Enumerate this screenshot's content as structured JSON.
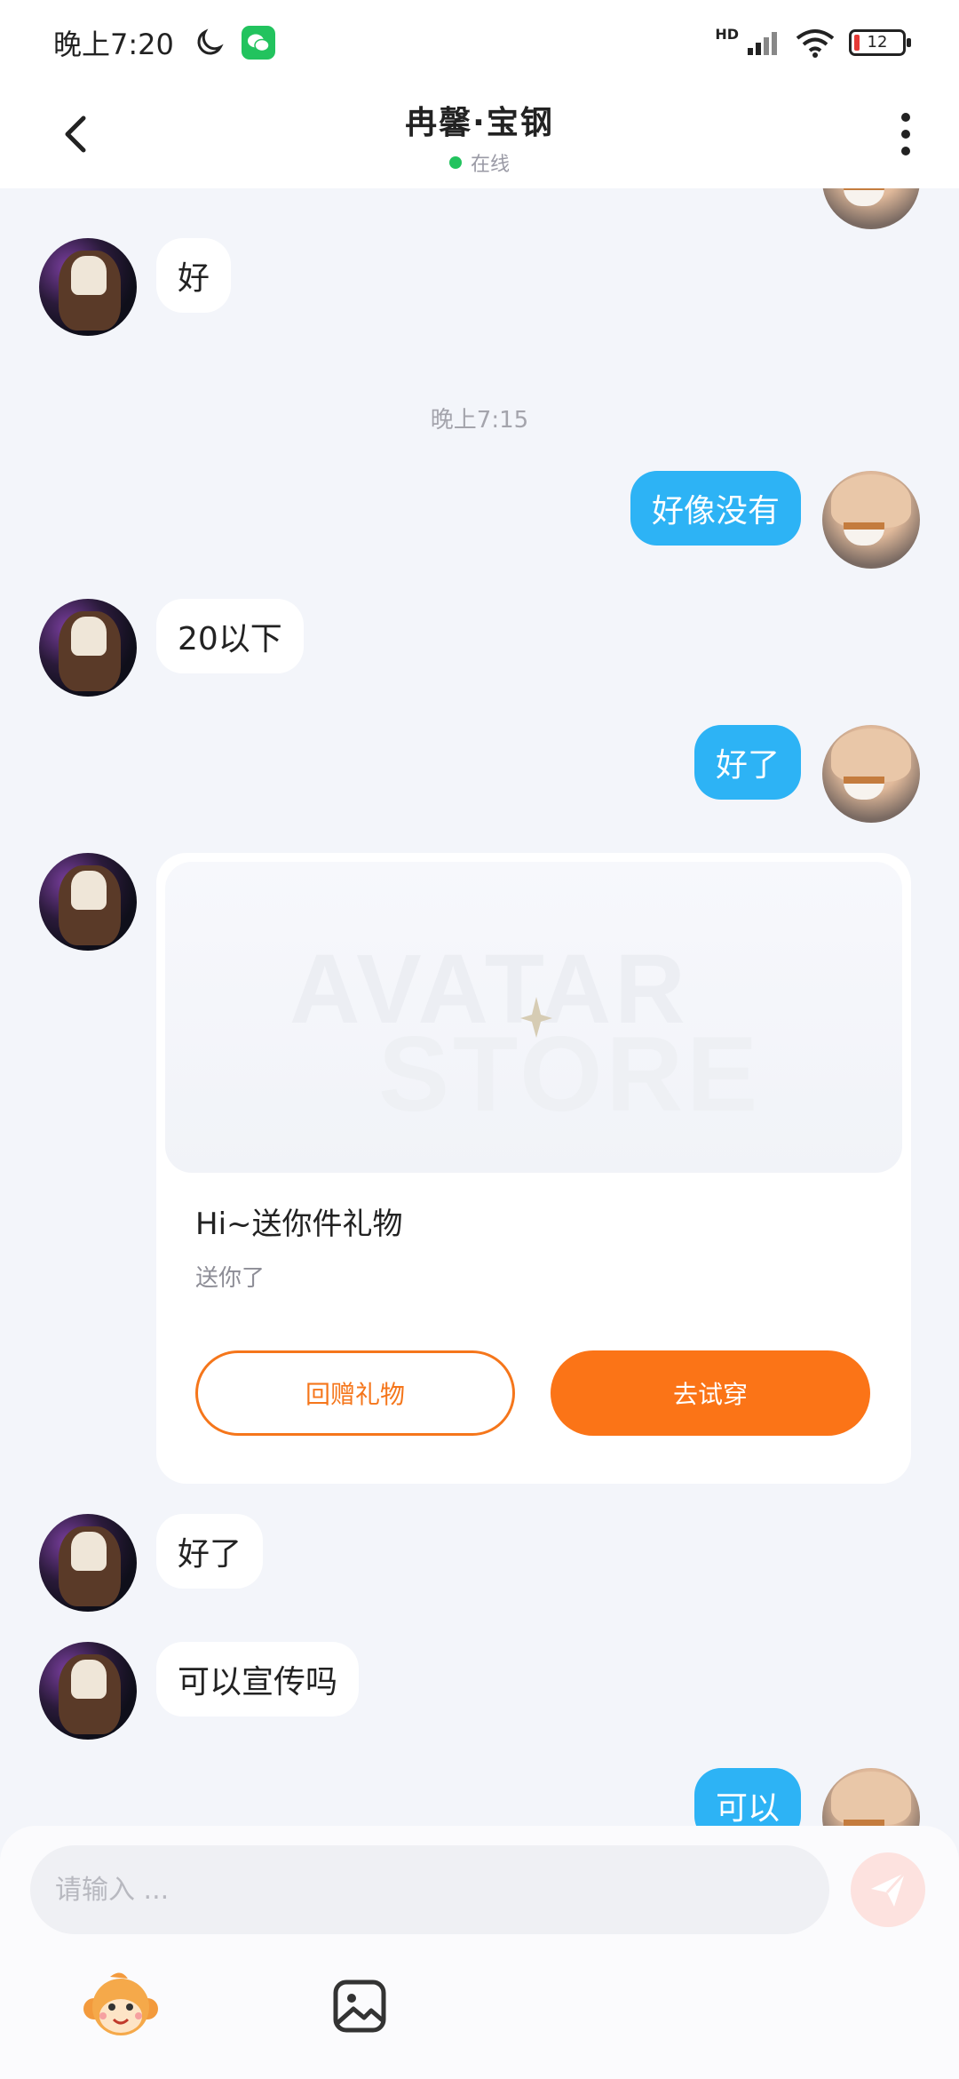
{
  "status_bar": {
    "time": "晚上7:20",
    "network": "HD",
    "battery_level": "12",
    "battery_level_fraction": 0.12
  },
  "header": {
    "title": "冉馨·宝钢",
    "online_status": "在线"
  },
  "messages": {
    "m1": "好",
    "timestamp": "晚上7:15",
    "m2": "好像没有",
    "m3": "20以下",
    "m4": "好了",
    "m5": "好了",
    "m6": "可以宣传吗",
    "m7": "可以"
  },
  "gift_card": {
    "watermark_line1": "AVATAR",
    "watermark_line2": "STORE",
    "title": "Hi~送你件礼物",
    "subtitle": "送你了",
    "return_gift_label": "回赠礼物",
    "try_on_label": "去试穿"
  },
  "composer": {
    "placeholder": "请输入 ..."
  },
  "colors": {
    "accent_blue": "#2db3f5",
    "accent_orange": "#fb7417",
    "online_green": "#22c35e"
  },
  "icons": {
    "back": "chevron-left-icon",
    "more": "more-vertical-icon",
    "send": "paper-plane-icon",
    "emoji": "monkey-emoji-icon",
    "image": "image-icon"
  }
}
